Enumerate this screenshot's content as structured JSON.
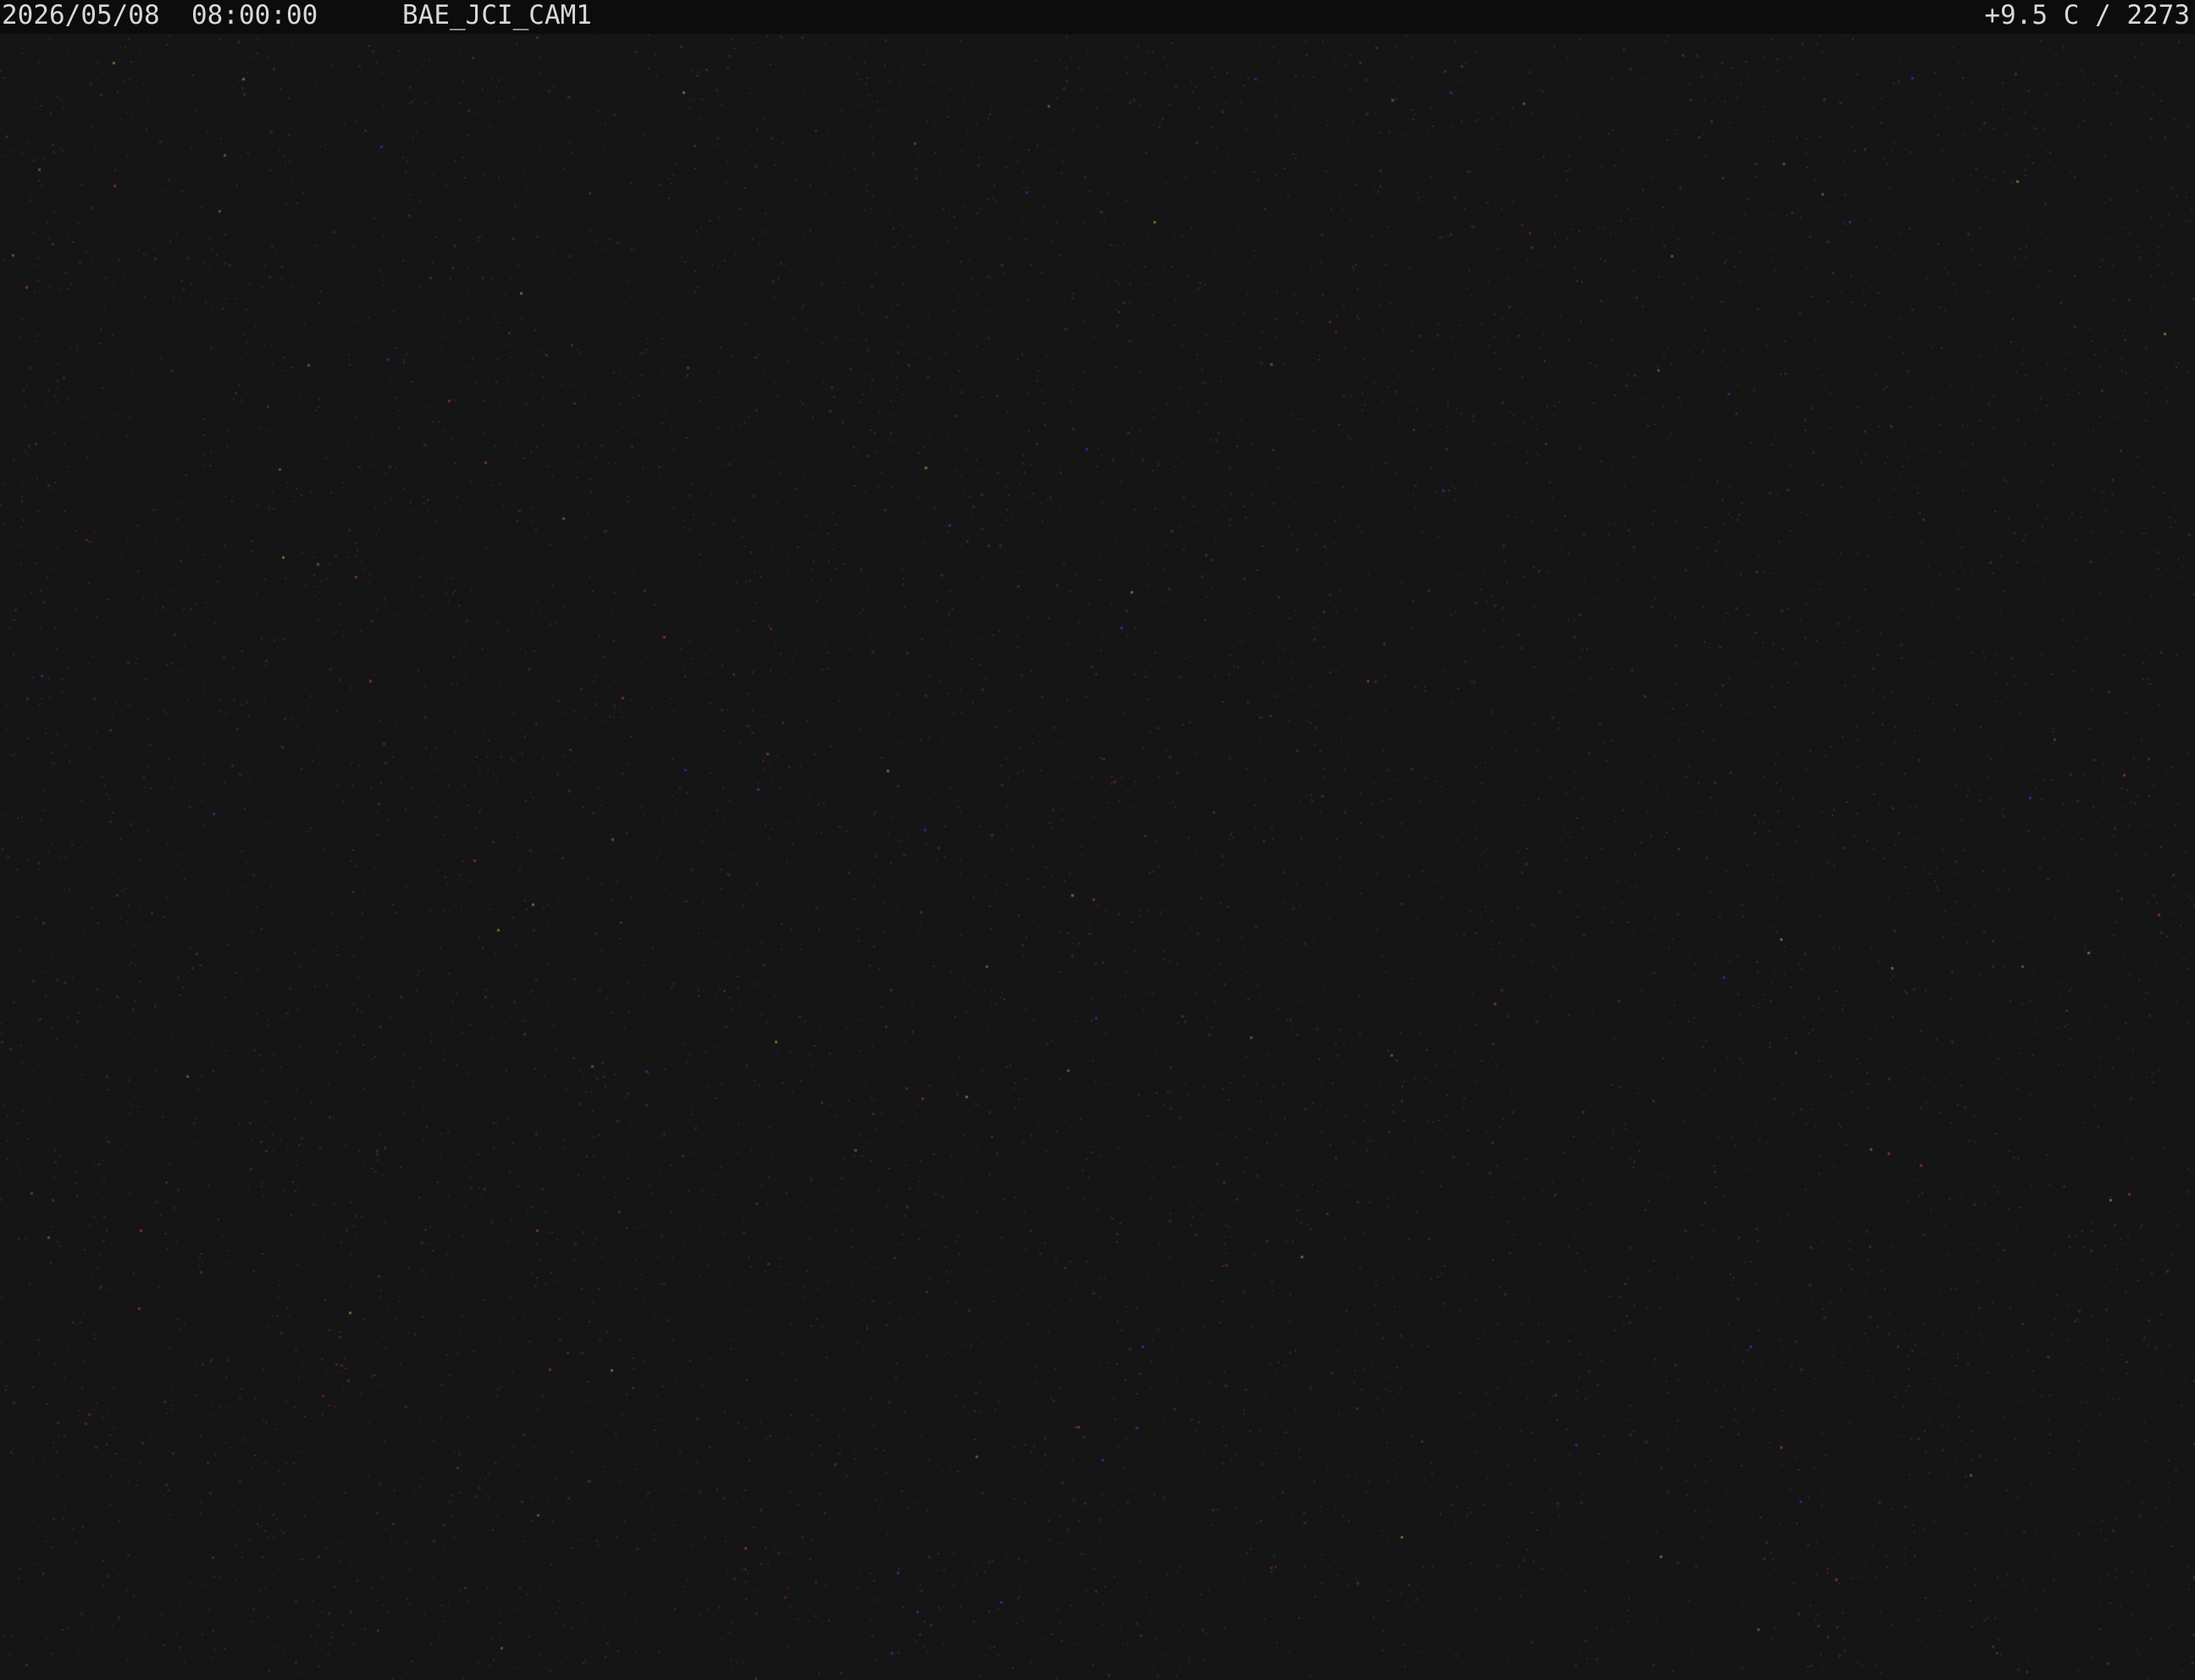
{
  "overlay": {
    "date": "2026/05/08",
    "time": "08:00:00",
    "camera_id": "BAE_JCI_CAM1",
    "temperature_reading": "+9.5 C / 2273"
  },
  "colors": {
    "background": "#151515",
    "overlay_bar": "#0c0c0c",
    "overlay_text": "#d8d8d8"
  }
}
